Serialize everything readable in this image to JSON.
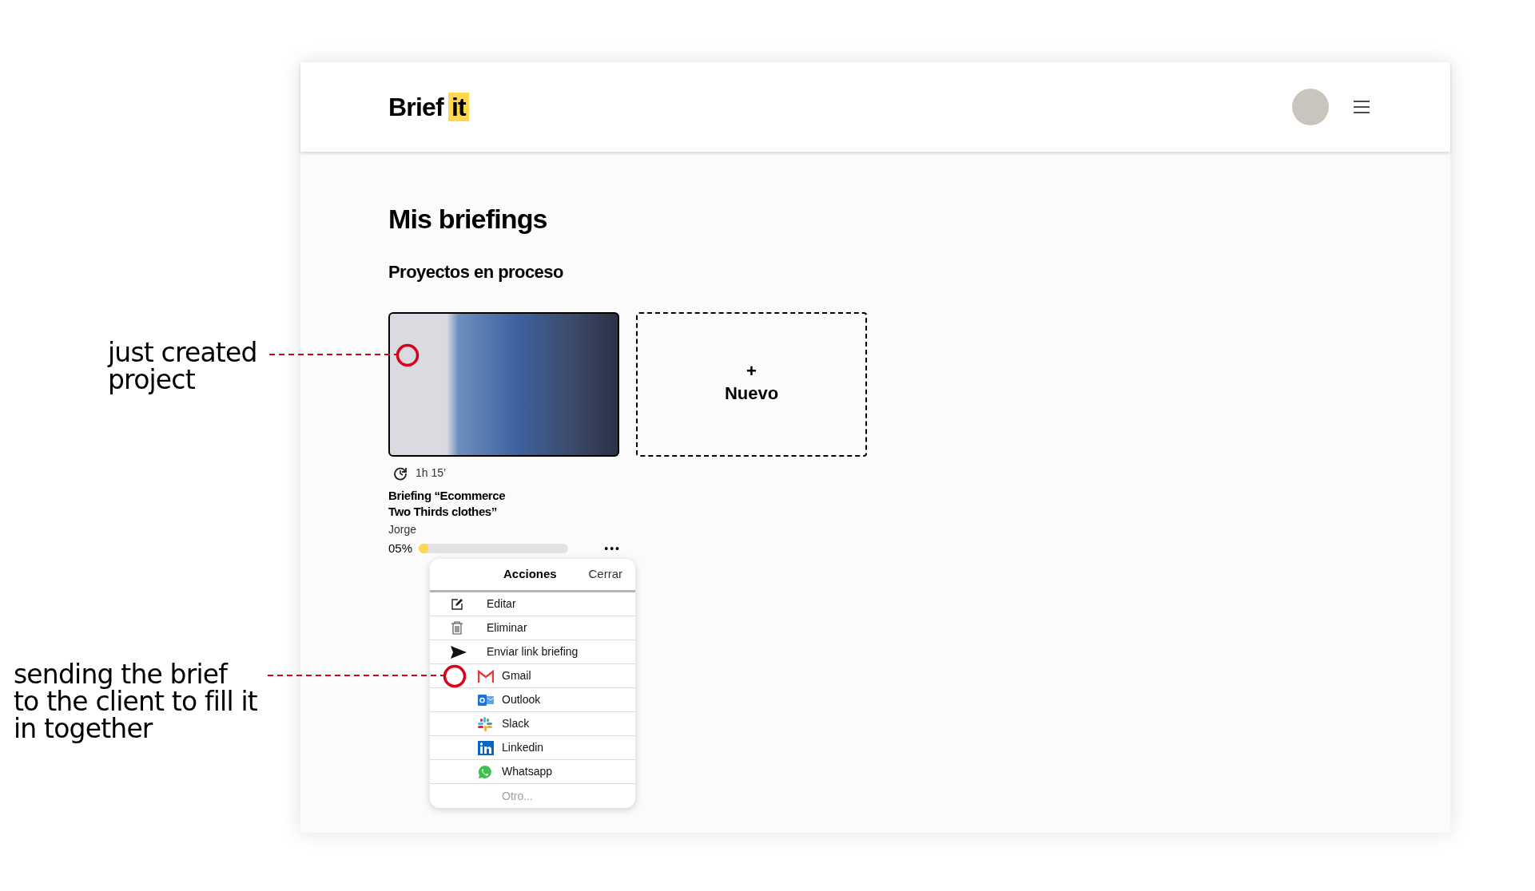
{
  "annotations": [
    {
      "text": "just created\nproject",
      "kind": "card"
    },
    {
      "text": "sending the brief\nto the client to fill it\nin together",
      "kind": "menu"
    }
  ],
  "header": {
    "logo_word": "Brief",
    "logo_highlight": "it"
  },
  "page": {
    "title": "Mis briefings",
    "section": "Proyectos en proceso"
  },
  "projects": [
    {
      "time": "1h 15’",
      "title": "Briefing “Ecommerce\nTwo Thirds clothes”",
      "owner": "Jorge",
      "progress": "05%",
      "level": 0.05
    }
  ],
  "new_card": {
    "plus": "+",
    "label": "Nuevo"
  },
  "more_button": "•••",
  "actions_menu": {
    "title": "Acciones",
    "close": "Cerrar",
    "items": [
      {
        "kind": "edit",
        "label": "Editar"
      },
      {
        "kind": "delete",
        "label": "Eliminar"
      },
      {
        "kind": "send",
        "label": "Enviar link briefing"
      },
      {
        "kind": "gmail",
        "label": "Gmail"
      },
      {
        "kind": "outlook",
        "label": "Outlook"
      },
      {
        "kind": "slack",
        "label": "Slack"
      },
      {
        "kind": "linkedin",
        "label": "Linkedin"
      },
      {
        "kind": "whatsapp",
        "label": "Whatsapp"
      },
      {
        "kind": "other",
        "label": "Otro..."
      }
    ]
  }
}
